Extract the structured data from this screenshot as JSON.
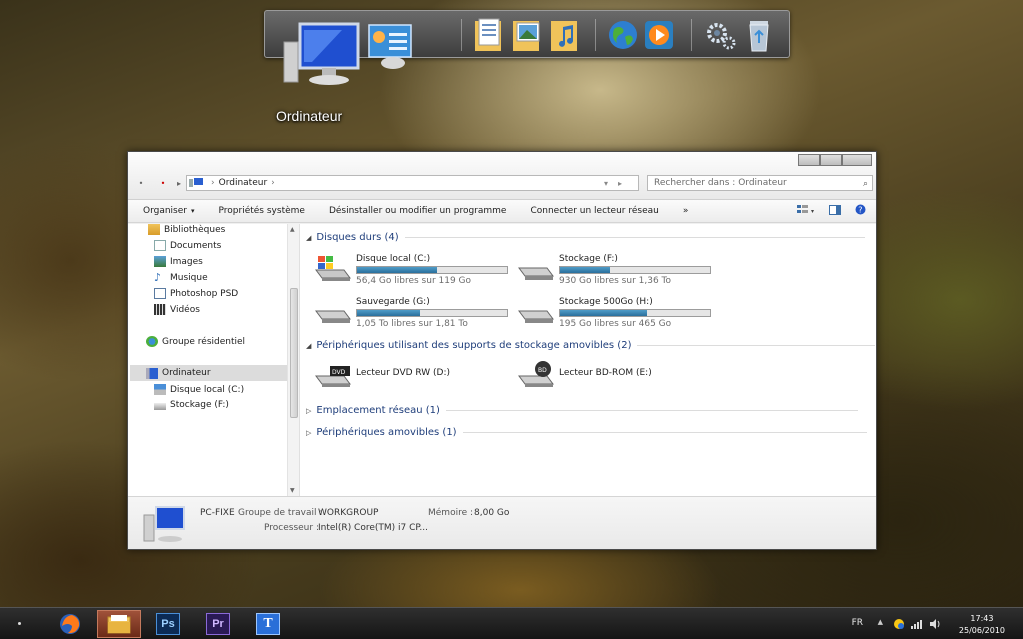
{
  "dock": {
    "label": "Ordinateur",
    "icons": [
      "computer-icon",
      "control-panel-icon",
      "documents-folder-icon",
      "pictures-folder-icon",
      "music-folder-icon",
      "globe-icon",
      "media-player-icon",
      "settings-gears-icon",
      "recycle-bin-icon"
    ]
  },
  "window": {
    "address": {
      "location": "Ordinateur"
    },
    "search": {
      "placeholder": "Rechercher dans : Ordinateur"
    },
    "toolbar": {
      "organize": "Organiser",
      "system_properties": "Propriétés système",
      "uninstall": "Désinstaller ou modifier un programme",
      "map_drive": "Connecter un lecteur réseau",
      "more": "»"
    },
    "nav": {
      "libraries": "Bibliothèques",
      "documents": "Documents",
      "images": "Images",
      "music": "Musique",
      "photoshop": "Photoshop PSD",
      "videos": "Vidéos",
      "homegroup": "Groupe résidentiel",
      "computer": "Ordinateur",
      "local_disk": "Disque local (C:)",
      "storage": "Stockage (F:)"
    },
    "groups": {
      "hard_drives": "Disques durs (4)",
      "removable_storage": "Périphériques utilisant des supports de stockage amovibles (2)",
      "network": "Emplacement réseau (1)",
      "removable_devices": "Périphériques amovibles (1)"
    },
    "drives": [
      {
        "name": "Disque local (C:)",
        "free": "56,4 Go libres sur 119 Go",
        "used_fraction": 0.53
      },
      {
        "name": "Stockage (F:)",
        "free": "930 Go libres sur 1,36 To",
        "used_fraction": 0.33
      },
      {
        "name": "Sauvegarde (G:)",
        "free": "1,05 To libres sur 1,81 To",
        "used_fraction": 0.42
      },
      {
        "name": "Stockage 500Go (H:)",
        "free": "195 Go libres sur 465 Go",
        "used_fraction": 0.58
      }
    ],
    "removable": [
      {
        "name": "Lecteur DVD RW (D:)",
        "badge": "DVD"
      },
      {
        "name": "Lecteur BD-ROM (E:)",
        "badge": "BD"
      }
    ],
    "details": {
      "pc_name": "PC-FIXE",
      "workgroup_label": "Groupe de travail :",
      "workgroup_value": "WORKGROUP",
      "memory_label": "Mémoire :",
      "memory_value": "8,00 Go",
      "processor_label": "Processeur :",
      "processor_value": "Intel(R) Core(TM) i7 CP..."
    }
  },
  "taskbar": {
    "apps": [
      "firefox-icon",
      "explorer-icon",
      "photoshop-icon",
      "premiere-icon",
      "typography-app-icon"
    ],
    "ps_label": "Ps",
    "pr_label": "Pr",
    "t_label": "T",
    "language": "FR",
    "time": "17:43",
    "date": "25/06/2010"
  }
}
